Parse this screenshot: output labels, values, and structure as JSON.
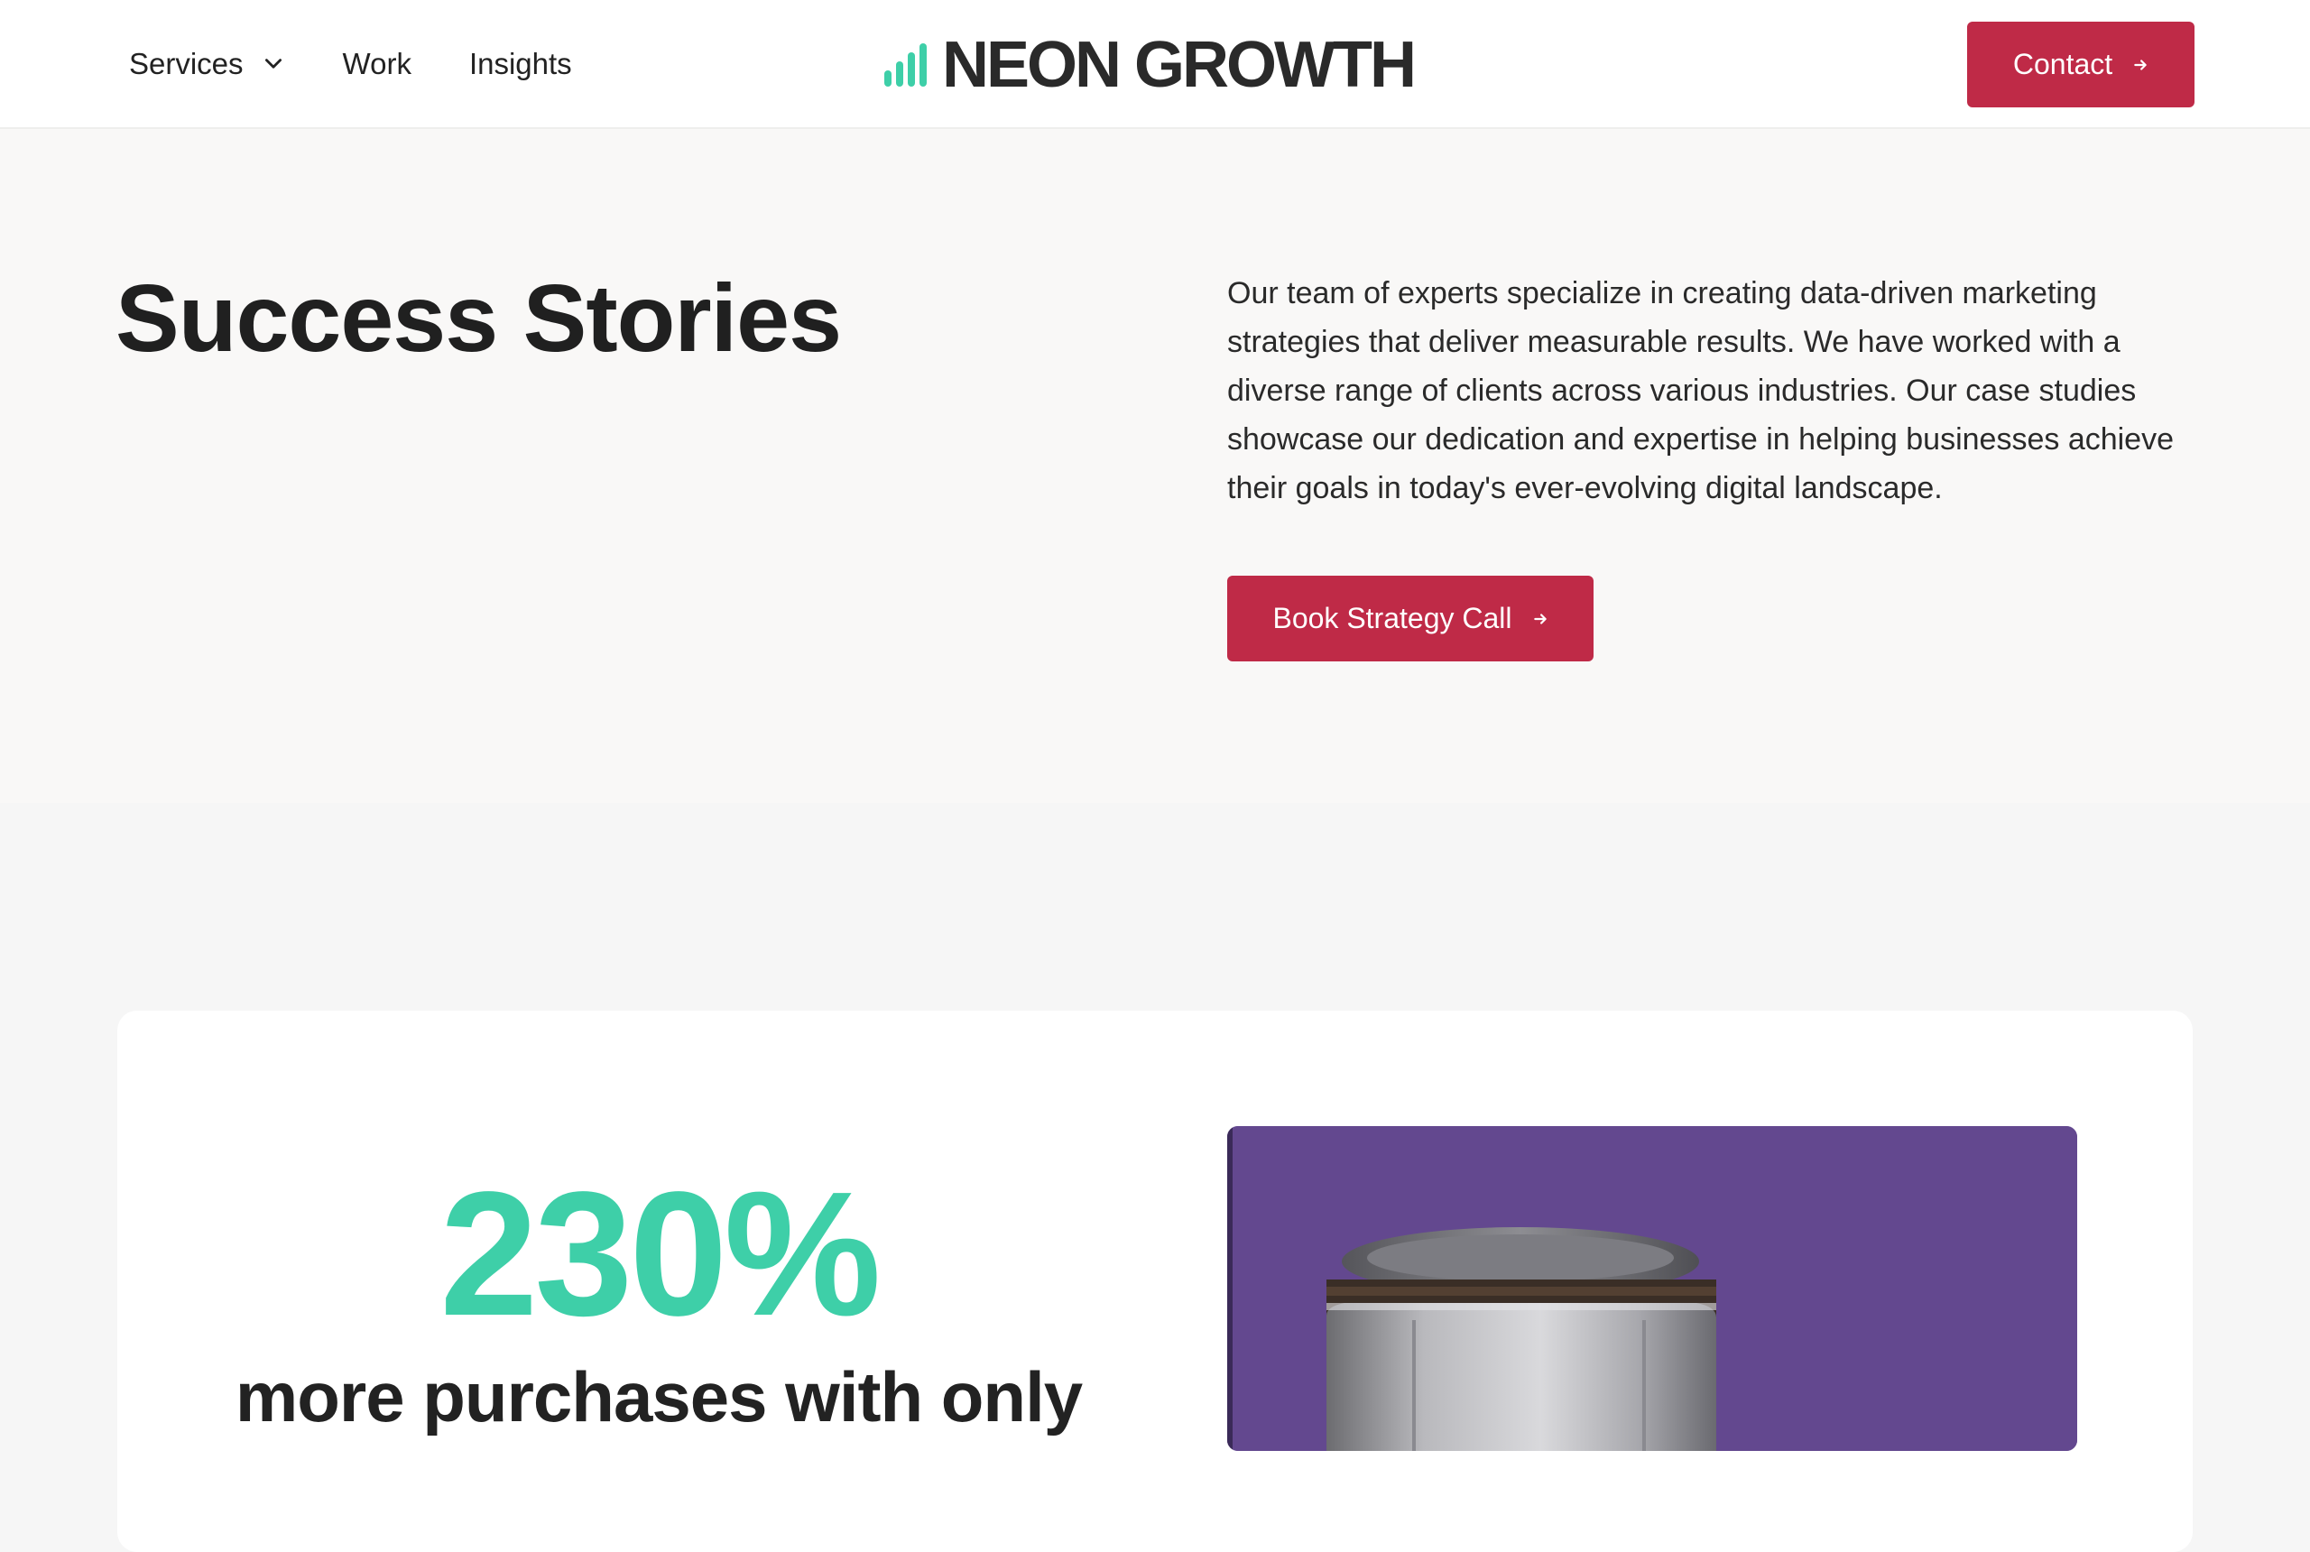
{
  "header": {
    "nav": [
      {
        "label": "Services",
        "has_dropdown": true
      },
      {
        "label": "Work"
      },
      {
        "label": "Insights"
      }
    ],
    "logo_text": "NEON GROWTH",
    "contact_label": "Contact"
  },
  "hero": {
    "title": "Success Stories",
    "description": "Our team of experts specialize in creating data-driven marketing strategies that deliver measurable results. We have worked with a diverse range of clients across various industries. Our case studies showcase our dedication and expertise in helping businesses achieve their goals in today's ever-evolving digital landscape.",
    "cta_label": "Book Strategy Call"
  },
  "case_study": {
    "stat_value": "230%",
    "stat_text": "more purchases with only"
  },
  "colors": {
    "accent": "#bf2a47",
    "brand_green": "#3ecfa8",
    "product_bg": "#63488f"
  }
}
